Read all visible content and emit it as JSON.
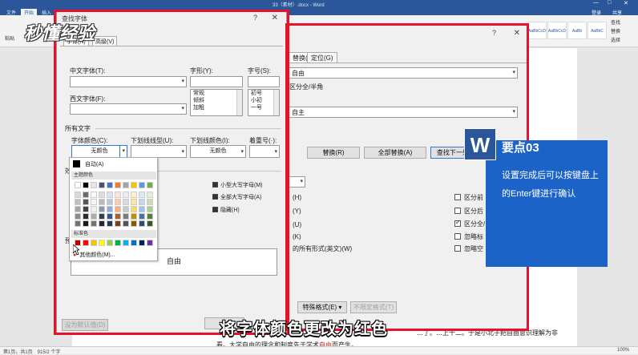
{
  "word": {
    "doc_title": "33（素材）.docx - Word",
    "tabs": [
      "文件",
      "开始",
      "插入"
    ],
    "right_tabs": [
      "登录",
      "共享"
    ],
    "ribbon_left": "粘贴",
    "ribbon_right": [
      "查找",
      "替换",
      "选择"
    ],
    "styles": [
      "AaBbCcD",
      "AaBbCcD",
      "AaBb",
      "AaBbC",
      "AaBbCcD"
    ]
  },
  "replace_dialog": {
    "tabs": [
      "替换(P)",
      "定位(G)"
    ],
    "find_value": "自由",
    "find_option": "区分全/半角",
    "replace_value": "自主",
    "buttons": {
      "replace": "替换(R)",
      "replace_all": "全部替换(A)",
      "find_next": "查找下一处(F)",
      "special": "特殊格式(E) ▾",
      "no_format": "不限定格式(T)"
    },
    "options_left": [
      "(H)",
      "(Y)",
      "(U)",
      "(K)",
      "的所有形式(英文)(W)"
    ],
    "options_right": [
      {
        "label": "区分前",
        "checked": false
      },
      {
        "label": "区分后",
        "checked": false
      },
      {
        "label": "区分全/",
        "checked": true
      },
      {
        "label": "忽略标",
        "checked": false
      },
      {
        "label": "忽略空",
        "checked": false
      }
    ]
  },
  "font_dialog": {
    "title": "查找字体",
    "help": "?",
    "tabs": [
      "字体(N)",
      "高级(V)"
    ],
    "labels": {
      "cn_font": "中文字体(T):",
      "west_font": "西文字体(F):",
      "style": "字形(Y):",
      "size": "字号(S):",
      "all_text": "所有文字",
      "font_color": "字体颜色(C):",
      "underline_type": "下划线线型(U):",
      "underline_color": "下划线颜色(I):",
      "emphasis": "着重号(·):",
      "effects": "效",
      "preview_label": "预"
    },
    "styles_list": [
      "常规",
      "倾斜",
      "加粗"
    ],
    "size_list": [
      "初号",
      "小初",
      "一号"
    ],
    "font_color_value": "无颜色",
    "underline_color_value": "无颜色",
    "effects": [
      "小型大写字母(M)",
      "全部大写字母(A)",
      "隐藏(H)"
    ],
    "preview_text": "自由",
    "bottom_left": "设为默认值(D)"
  },
  "palette": {
    "auto": "自动(A)",
    "theme_label": "主题颜色",
    "standard_label": "标准色",
    "more": "其他颜色(M)...",
    "theme_top": [
      "#ffffff",
      "#000000",
      "#e7e6e6",
      "#44546a",
      "#4472c4",
      "#ed7d31",
      "#a5a5a5",
      "#ffc000",
      "#5b9bd5",
      "#70ad47"
    ],
    "standard": [
      "#c00000",
      "#ff0000",
      "#ffc000",
      "#ffff00",
      "#92d050",
      "#00b050",
      "#00b0f0",
      "#0070c0",
      "#002060",
      "#7030a0"
    ]
  },
  "document": {
    "line1": "…了。…上十二。于是小北子把自由意识理解为非",
    "line2_a": "看。大学自由的理念和制度先于学术",
    "line2_b": "自由",
    "line2_c": "而产生。"
  },
  "status": {
    "left": "第1页，共1页　915/2 个字",
    "zoom": "100%"
  },
  "card": {
    "logo": "W",
    "title": "要点03",
    "text": "设置完成后可以按键盘上的Enter键进行确认"
  },
  "watermark": "秒懂经验",
  "subtitle": "将字体颜色更改为红色",
  "colors": {
    "frame": "#e8102a",
    "card": "#1c63c8",
    "word_blue": "#2b579a"
  }
}
